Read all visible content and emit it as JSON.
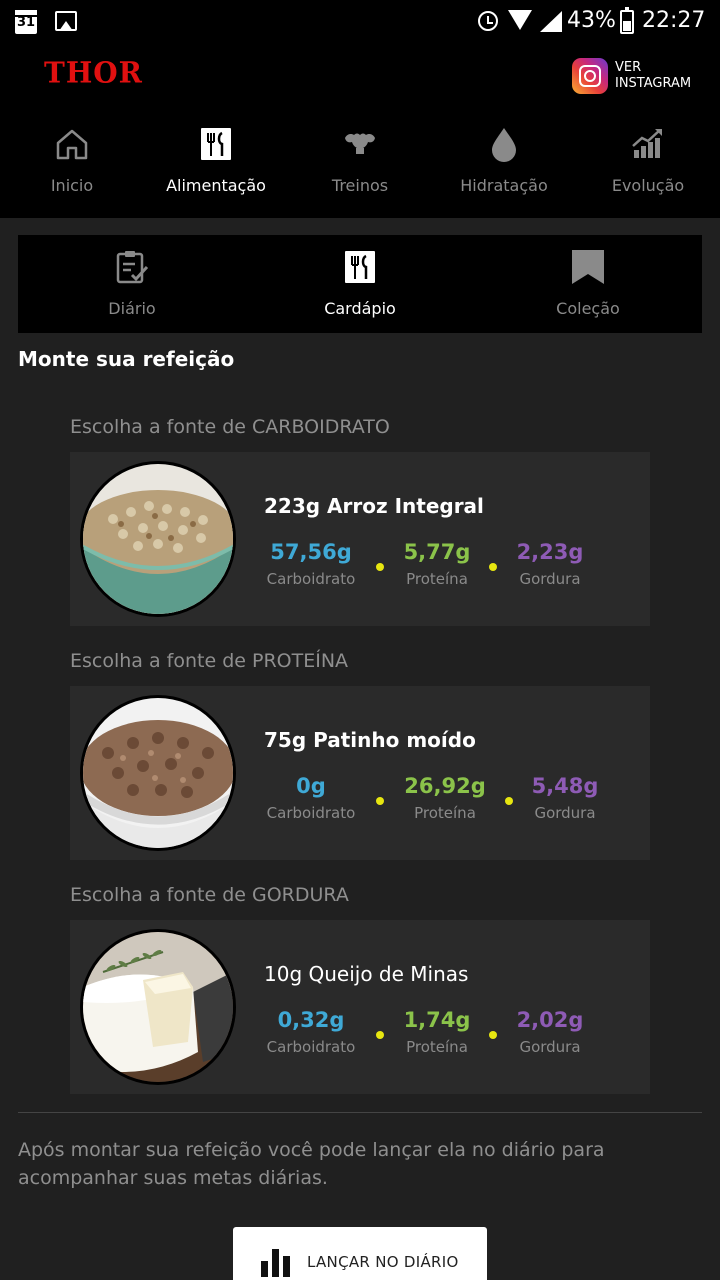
{
  "status_bar": {
    "calendar_day": "31",
    "battery_percent": "43%",
    "time": "22:27"
  },
  "header": {
    "logo_text": "THOR",
    "instagram_label_line1": "VER",
    "instagram_label_line2": "INSTAGRAM"
  },
  "nav": [
    {
      "label": "Inicio",
      "icon": "home-icon",
      "active": false
    },
    {
      "label": "Alimentação",
      "icon": "cutlery-icon",
      "active": true
    },
    {
      "label": "Treinos",
      "icon": "muscle-icon",
      "active": false
    },
    {
      "label": "Hidratação",
      "icon": "water-drop-icon",
      "active": false
    },
    {
      "label": "Evolução",
      "icon": "chart-up-icon",
      "active": false
    }
  ],
  "subtabs": [
    {
      "label": "Diário",
      "icon": "checklist-icon",
      "active": false
    },
    {
      "label": "Cardápio",
      "icon": "cutlery-icon",
      "active": true
    },
    {
      "label": "Coleção",
      "icon": "bookmark-icon",
      "active": false
    }
  ],
  "section_title": "Monte sua refeição",
  "groups": [
    {
      "label": "Escolha a fonte de CARBOIDRATO",
      "food": "223g Arroz Integral",
      "image": "brown-rice-bowl",
      "carb": "57,56g",
      "protein": "5,77g",
      "fat": "2,23g"
    },
    {
      "label": "Escolha a fonte de PROTEÍNA",
      "food": "75g Patinho moído",
      "image": "ground-beef-bowl",
      "carb": "0g",
      "protein": "26,92g",
      "fat": "5,48g"
    },
    {
      "label": "Escolha a fonte de GORDURA",
      "food": "10g Queijo de Minas",
      "image": "white-cheese",
      "carb": "0,32g",
      "protein": "1,74g",
      "fat": "2,02g"
    }
  ],
  "macro_labels": {
    "carb": "Carboidrato",
    "protein": "Proteína",
    "fat": "Gordura"
  },
  "colors": {
    "carb": "#3fa9d6",
    "protein": "#8bc34a",
    "fat": "#8e5bb5",
    "dot": "#e7e610",
    "logo": "#e01010"
  },
  "footer_note": "Após montar sua refeição você pode lançar ela no diário para acompanhar suas metas diárias.",
  "cta_label": "LANÇAR NO DIÁRIO"
}
